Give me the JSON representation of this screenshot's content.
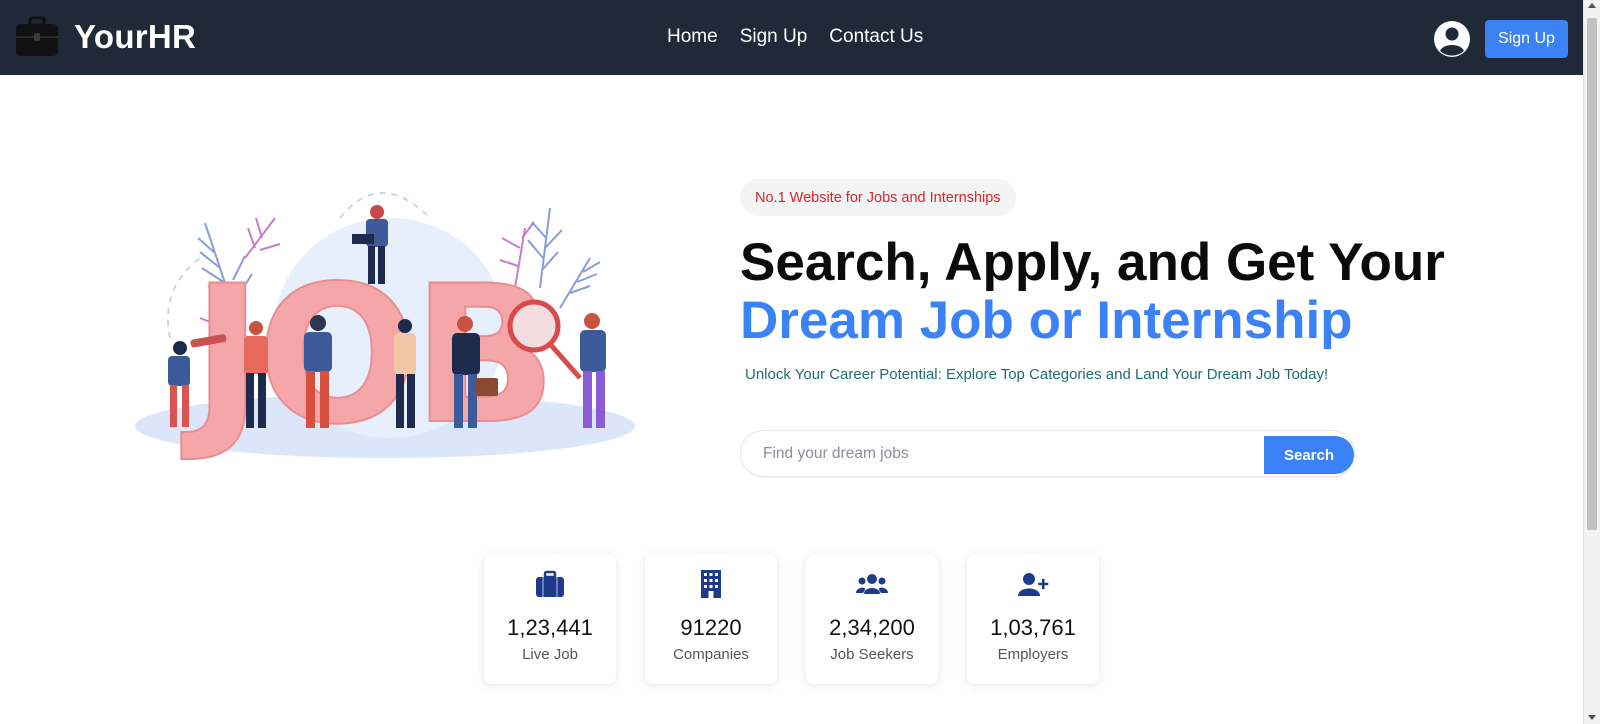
{
  "navbar": {
    "brand": "YourHR",
    "links": [
      "Home",
      "Sign Up",
      "Contact Us"
    ],
    "signup_button": "Sign Up",
    "bg_color": "#1f2937"
  },
  "hero": {
    "tagline": "No.1 Website for Jobs and Internships",
    "headline_line1": "Search, Apply, and Get Your",
    "headline_line2": "Dream Job or Internship",
    "subtext": "Unlock Your Career Potential: Explore Top Categories and Land Your Dream Job Today!",
    "illustration_text": "JOB",
    "accent_color": "#3b82f6"
  },
  "search": {
    "placeholder": "Find your dream jobs",
    "value": "",
    "button": "Search"
  },
  "stats": [
    {
      "icon": "briefcase-icon",
      "value": "1,23,441",
      "label": "Live Job"
    },
    {
      "icon": "building-icon",
      "value": "91220",
      "label": "Companies"
    },
    {
      "icon": "users-icon",
      "value": "2,34,200",
      "label": "Job Seekers"
    },
    {
      "icon": "user-plus-icon",
      "value": "1,03,761",
      "label": "Employers"
    }
  ]
}
